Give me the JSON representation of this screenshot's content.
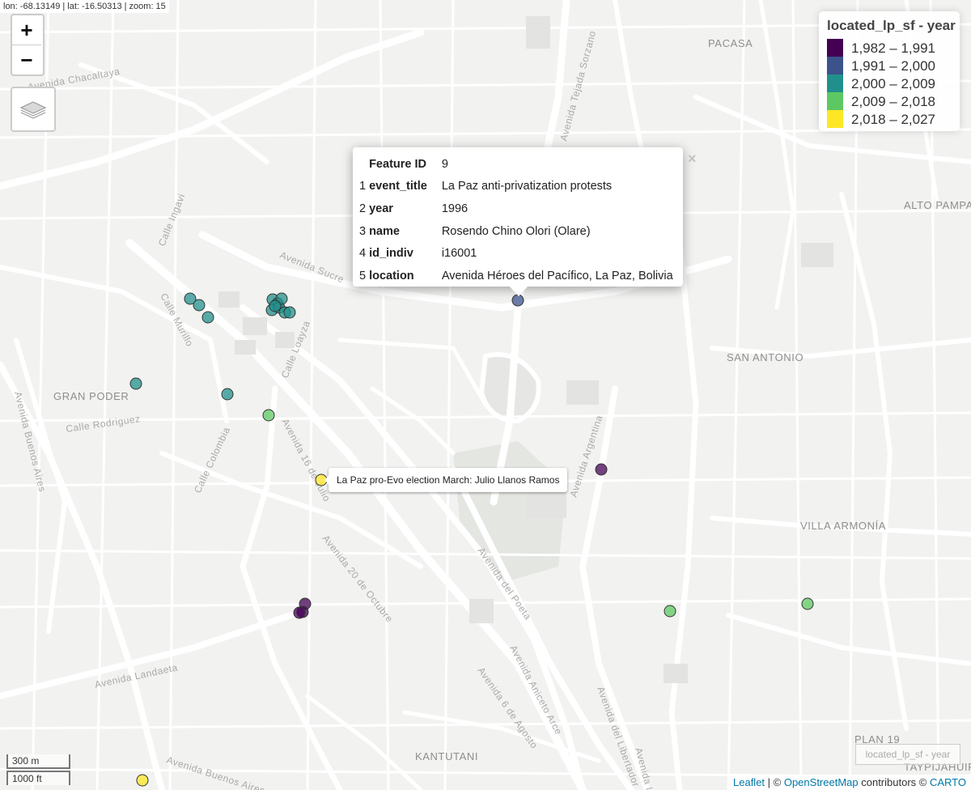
{
  "coords": "lon: -68.13149 | lat: -16.50313 | zoom: 15",
  "zoom": {
    "in": "+",
    "out": "−"
  },
  "layers_icon": "layers-icon",
  "places": [
    "PACASA",
    "ALTO PAMPA",
    "SAN ANTONIO",
    "GRAN PODER",
    "VILLA ARMONÍA",
    "KANTUTANI",
    "PLAN 19",
    "TAYPIJAHUIR"
  ],
  "streets": [
    "Avenida Chacaltaya",
    "Avenida Tejada Sorzano",
    "Calle Ingavi",
    "Avenida Sucre",
    "Calle Murillo",
    "Calle Loayza",
    "Avenida Buenos Aires",
    "Calle Rodriguez",
    "Calle Colombia",
    "Avenida 16 de Julio",
    "Avenida Argentina",
    "Avenida 20 de Octubre",
    "Avenida del Poeta",
    "Avenida Landaeta",
    "Avenida Aniceto Arce",
    "Avenida 6 de Agosto",
    "Avenida del Libertador",
    "Avenida Buenos Aires",
    "Avenida Los"
  ],
  "legend": {
    "title": "located_lp_sf - year",
    "items": [
      {
        "label": "1,982 – 1,991",
        "color": "#440154"
      },
      {
        "label": "1,991 – 2,000",
        "color": "#3b528b"
      },
      {
        "label": "2,000 – 2,009",
        "color": "#21908c"
      },
      {
        "label": "2,009 – 2,018",
        "color": "#5dc863"
      },
      {
        "label": "2,018 – 2,027",
        "color": "#fde725"
      }
    ]
  },
  "popup": {
    "rows": [
      {
        "num": "",
        "key": "Feature ID",
        "value": "9"
      },
      {
        "num": "1",
        "key": "event_title",
        "value": "La Paz anti-privatization protests"
      },
      {
        "num": "2",
        "key": "year",
        "value": "1996"
      },
      {
        "num": "3",
        "key": "name",
        "value": "Rosendo Chino Olori (Olare)"
      },
      {
        "num": "4",
        "key": "id_indiv",
        "value": "i16001"
      },
      {
        "num": "5",
        "key": "location",
        "value": "Avenida Héroes del Pacífico, La Paz, Bolivia"
      }
    ],
    "close": "×"
  },
  "tooltip": "La Paz pro-Evo election March: Julio Llanos Ramos",
  "scale": {
    "metric": "300 m",
    "imperial": "1000 ft"
  },
  "minimap_label": "located_lp_sf - year",
  "attribution": {
    "leaflet": "Leaflet",
    "sep": " | © ",
    "osm": "OpenStreetMap",
    "contrib": " contributors © ",
    "carto": "CARTO"
  },
  "markers": [
    {
      "year_band": 2,
      "color": "#21908c"
    },
    {
      "year_band": 2,
      "color": "#21908c"
    },
    {
      "year_band": 2,
      "color": "#21908c"
    },
    {
      "year_band": 2,
      "color": "#21908c"
    },
    {
      "year_band": 2,
      "color": "#21908c"
    },
    {
      "year_band": 2,
      "color": "#21908c"
    },
    {
      "year_band": 2,
      "color": "#21908c"
    },
    {
      "year_band": 2,
      "color": "#21908c"
    },
    {
      "year_band": 2,
      "color": "#21908c"
    },
    {
      "year_band": 2,
      "color": "#21908c"
    },
    {
      "year_band": 2,
      "color": "#21908c"
    },
    {
      "year_band": 2,
      "color": "#21908c"
    },
    {
      "year_band": 2,
      "color": "#21908c"
    },
    {
      "year_band": 1,
      "color": "#3b528b"
    },
    {
      "year_band": 3,
      "color": "#5dc863"
    },
    {
      "year_band": 4,
      "color": "#fde725"
    },
    {
      "year_band": 0,
      "color": "#440154"
    },
    {
      "year_band": 0,
      "color": "#440154"
    },
    {
      "year_band": 0,
      "color": "#440154"
    },
    {
      "year_band": 0,
      "color": "#440154"
    },
    {
      "year_band": 3,
      "color": "#5dc863"
    },
    {
      "year_band": 3,
      "color": "#5dc863"
    },
    {
      "year_band": 4,
      "color": "#fde725"
    }
  ]
}
